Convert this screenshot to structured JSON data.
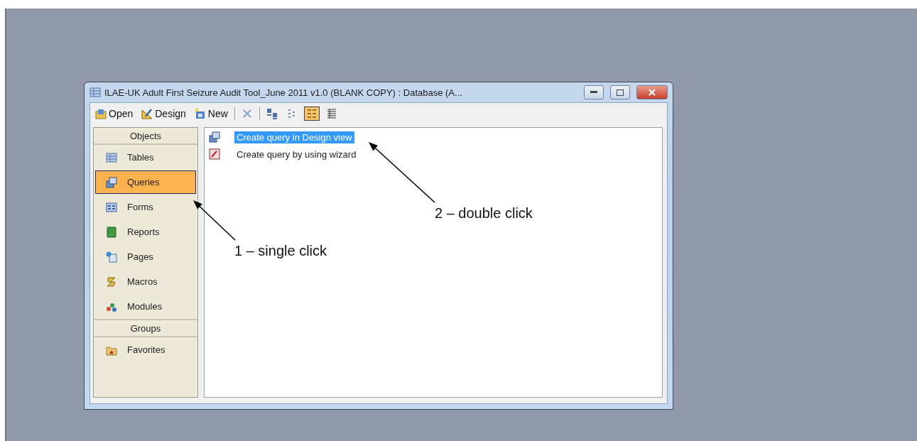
{
  "window": {
    "title": "ILAE-UK Adult First Seizure Audit Tool_June 2011 v1.0 (BLANK COPY) : Database (A..."
  },
  "toolbar": [
    {
      "kind": "labeled",
      "label": "Open"
    },
    {
      "kind": "labeled",
      "label": "Design"
    },
    {
      "kind": "labeled",
      "label": "New"
    },
    {
      "kind": "separator"
    },
    {
      "kind": "icon",
      "selected": false
    },
    {
      "kind": "separator"
    },
    {
      "kind": "icon",
      "selected": false
    },
    {
      "kind": "icon",
      "selected": false
    },
    {
      "kind": "icon",
      "selected": true
    },
    {
      "kind": "icon",
      "selected": false
    }
  ],
  "sidebar": {
    "sections": [
      {
        "header": "Objects",
        "items": [
          {
            "label": "Tables",
            "selected": false
          },
          {
            "label": "Queries",
            "selected": true
          },
          {
            "label": "Forms",
            "selected": false
          },
          {
            "label": "Reports",
            "selected": false
          },
          {
            "label": "Pages",
            "selected": false
          },
          {
            "label": "Macros",
            "selected": false
          },
          {
            "label": "Modules",
            "selected": false
          }
        ]
      },
      {
        "header": "Groups",
        "items": [
          {
            "label": "Favorites",
            "selected": false
          }
        ]
      }
    ]
  },
  "list": [
    {
      "label": "Create query in Design view",
      "selected": true
    },
    {
      "label": "Create query by using wizard",
      "selected": false
    }
  ],
  "annotations": [
    {
      "text": "1 – single click"
    },
    {
      "text": "2 – double click"
    }
  ]
}
